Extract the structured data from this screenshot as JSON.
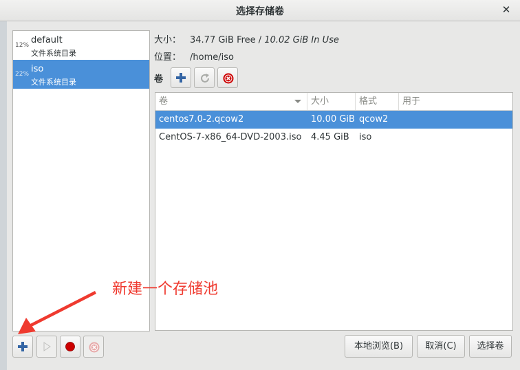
{
  "window": {
    "title": "选择存储卷",
    "close_glyph": "✕"
  },
  "pools": [
    {
      "percent": "12%",
      "name": "default",
      "type": "文件系统目录",
      "selected": false
    },
    {
      "percent": "22%",
      "name": "iso",
      "type": "文件系统目录",
      "selected": true
    }
  ],
  "info": {
    "size_label": "大小：",
    "size_free": "34.77 GiB Free",
    "size_sep": " / ",
    "size_used": "10.02 GiB In Use",
    "location_label": "位置：",
    "location_value": "/home/iso"
  },
  "volumes": {
    "label": "卷",
    "columns": [
      "卷",
      "大小",
      "格式",
      "用于"
    ],
    "rows": [
      {
        "name": "centos7.0-2.qcow2",
        "size": "10.00 GiB",
        "format": "qcow2",
        "used_by": "",
        "selected": true
      },
      {
        "name": "CentOS-7-x86_64-DVD-2003.iso",
        "size": "4.45 GiB",
        "format": "iso",
        "used_by": "",
        "selected": false
      }
    ]
  },
  "annotation": {
    "text": "新建一个存储池",
    "color": "#ef3a2f"
  },
  "buttons": {
    "browse_local": "本地浏览(B)",
    "cancel": "取消(C)",
    "choose_volume": "选择卷"
  },
  "icons": {
    "add": "plus-icon",
    "refresh": "refresh-icon",
    "delete": "delete-icon",
    "start": "play-icon",
    "stop": "record-icon"
  },
  "colors": {
    "selection": "#4a90d9",
    "add_icon": "#3465a4",
    "delete_icon": "#cc0000"
  }
}
